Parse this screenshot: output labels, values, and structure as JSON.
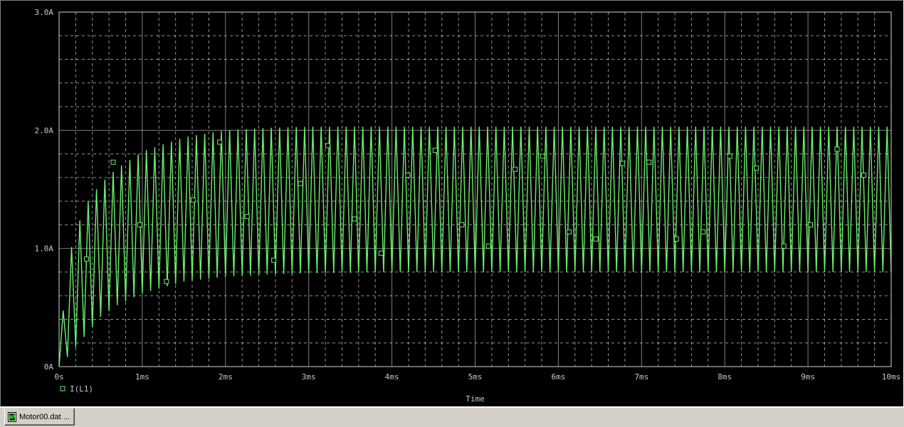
{
  "colors": {
    "background": "#000000",
    "grid": "#d2d2d2",
    "trace": "#6cf06c",
    "text": "#c8c8c8"
  },
  "chart_data": {
    "type": "line",
    "title": "",
    "xlabel": "Time",
    "ylabel": "",
    "xlim": [
      0,
      10
    ],
    "ylim": [
      0,
      3
    ],
    "x_unit": "ms",
    "y_unit": "A",
    "x_ticks": [
      "0s",
      "1ms",
      "2ms",
      "3ms",
      "4ms",
      "5ms",
      "6ms",
      "7ms",
      "8ms",
      "9ms",
      "10ms"
    ],
    "y_ticks": [
      "0A",
      "1.0A",
      "2.0A",
      "3.0A"
    ],
    "grid": true,
    "legend_position": "bottom-left",
    "series": [
      {
        "name": "I(L1)",
        "color": "#6cf06c",
        "marker": "square",
        "switching_period_ms": 0.1,
        "envelope_time_ms": [
          0,
          0.1,
          0.3,
          0.5,
          0.7,
          1.0,
          1.5,
          2.0,
          2.5,
          3.0,
          4.0,
          5.0,
          6.0,
          7.0,
          8.0,
          9.0,
          10.0
        ],
        "peak_A": [
          0.05,
          0.9,
          1.35,
          1.55,
          1.68,
          1.82,
          1.94,
          2.0,
          2.02,
          2.03,
          2.03,
          2.03,
          2.03,
          2.03,
          2.03,
          2.03,
          2.03
        ],
        "valley_A": [
          0.0,
          0.08,
          0.25,
          0.42,
          0.52,
          0.62,
          0.72,
          0.76,
          0.78,
          0.79,
          0.8,
          0.8,
          0.8,
          0.8,
          0.8,
          0.8,
          0.8
        ],
        "markers": [
          {
            "x": 0.33,
            "y": 0.91
          },
          {
            "x": 0.65,
            "y": 1.73
          },
          {
            "x": 0.97,
            "y": 1.2
          },
          {
            "x": 1.29,
            "y": 0.72
          },
          {
            "x": 1.61,
            "y": 1.41
          },
          {
            "x": 1.93,
            "y": 1.9
          },
          {
            "x": 2.26,
            "y": 1.27
          },
          {
            "x": 2.58,
            "y": 0.9
          },
          {
            "x": 2.9,
            "y": 1.55
          },
          {
            "x": 3.23,
            "y": 1.87
          },
          {
            "x": 3.55,
            "y": 1.25
          },
          {
            "x": 3.87,
            "y": 0.96
          },
          {
            "x": 4.19,
            "y": 1.62
          },
          {
            "x": 4.52,
            "y": 1.83
          },
          {
            "x": 4.84,
            "y": 1.2
          },
          {
            "x": 5.16,
            "y": 1.02
          },
          {
            "x": 5.48,
            "y": 1.67
          },
          {
            "x": 5.81,
            "y": 1.78
          },
          {
            "x": 6.13,
            "y": 1.14
          },
          {
            "x": 6.45,
            "y": 1.08
          },
          {
            "x": 6.77,
            "y": 1.72
          },
          {
            "x": 7.09,
            "y": 1.73
          },
          {
            "x": 7.42,
            "y": 1.08
          },
          {
            "x": 7.74,
            "y": 1.14
          },
          {
            "x": 8.06,
            "y": 1.78
          },
          {
            "x": 8.38,
            "y": 1.68
          },
          {
            "x": 8.71,
            "y": 1.02
          },
          {
            "x": 9.03,
            "y": 1.2
          },
          {
            "x": 9.35,
            "y": 1.84
          },
          {
            "x": 9.67,
            "y": 1.62
          }
        ]
      }
    ]
  },
  "tabbar": {
    "tab_label": "Motor00.dat ..."
  }
}
